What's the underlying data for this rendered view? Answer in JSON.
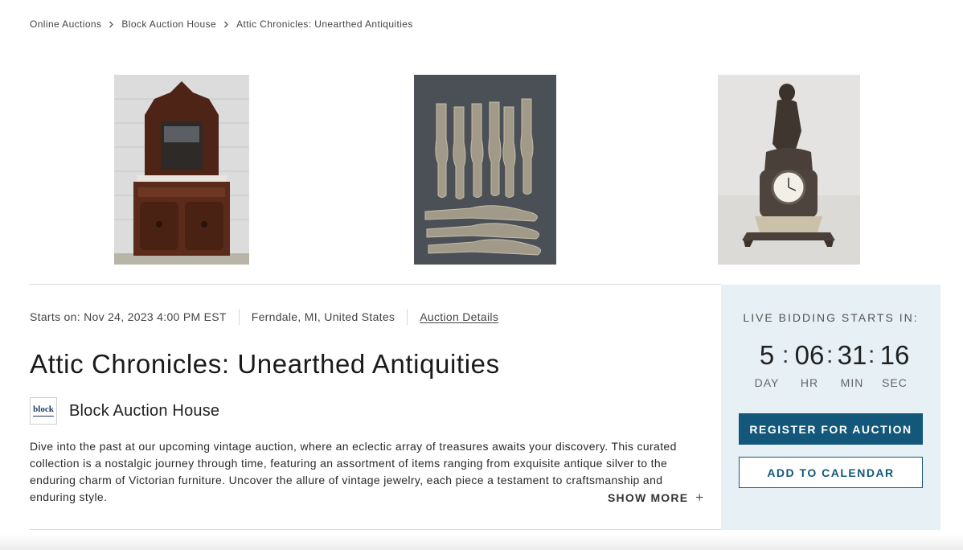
{
  "breadcrumb": {
    "items": [
      "Online Auctions",
      "Block Auction House",
      "Attic Chronicles: Unearthed Antiquities"
    ],
    "separator_icon": "chevron-right-icon"
  },
  "gallery": {
    "images": [
      {
        "subject": "Victorian carved wood sideboard with mirror"
      },
      {
        "subject": "Antique silver fiddle-pattern forks"
      },
      {
        "subject": "Bronze figural mantel clock"
      }
    ]
  },
  "auction": {
    "starts_on": "Starts on: Nov 24, 2023 4:00 PM EST",
    "location": "Ferndale, MI, United States",
    "details_link": "Auction Details",
    "title": "Attic Chronicles: Unearthed Antiquities",
    "house_name": "Block Auction House",
    "house_logo_text": "block",
    "description": "Dive into the past at our upcoming vintage auction, where an eclectic array of treasures awaits your discovery. This curated collection is a nostalgic journey through time, featuring an assortment of items ranging from exquisite antique silver to the enduring charm of Victorian furniture. Uncover the allure of vintage jewelry, each piece a testament to craftsmanship and enduring style.",
    "show_more": "SHOW MORE",
    "show_more_icon": "plus-icon"
  },
  "bidding": {
    "label": "LIVE BIDDING STARTS IN:",
    "countdown": [
      {
        "value": "5",
        "unit": "DAY"
      },
      {
        "value": "06",
        "unit": "HR"
      },
      {
        "value": "31",
        "unit": "MIN"
      },
      {
        "value": "16",
        "unit": "SEC"
      }
    ],
    "separator": ":",
    "register_button": "REGISTER FOR AUCTION",
    "calendar_button": "ADD TO CALENDAR"
  },
  "colors": {
    "accent": "#13587a",
    "panel_bg": "#e6f0f5",
    "logo_blue": "#1f3a6e"
  }
}
